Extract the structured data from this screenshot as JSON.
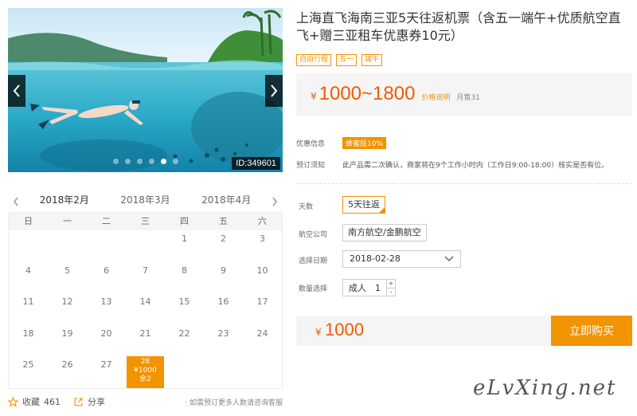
{
  "gallery": {
    "image_id": "ID:349601",
    "active_slide": 4,
    "slide_count": 6
  },
  "calendar": {
    "months": [
      "2018年2月",
      "2018年3月",
      "2018年4月"
    ],
    "active_month": 0,
    "weekdays": [
      "日",
      "一",
      "二",
      "三",
      "四",
      "五",
      "六"
    ],
    "leading_blanks": 4,
    "days": [
      "1",
      "2",
      "3",
      "4",
      "5",
      "6",
      "7",
      "8",
      "9",
      "10",
      "11",
      "12",
      "13",
      "14",
      "15",
      "16",
      "17",
      "18",
      "19",
      "20",
      "21",
      "22",
      "23",
      "24",
      "25",
      "26",
      "27",
      "28"
    ],
    "available_day": {
      "day": "28",
      "price": "¥1000",
      "stock": "余2"
    }
  },
  "footer": {
    "favorite_label": "收藏",
    "favorite_count": "461",
    "share_label": "分享",
    "note": "· 如需预订更多人数请咨询客服"
  },
  "product": {
    "title": "上海直飞海南三亚5天往返机票（含五一端午+优质航空直飞+赠三亚租车优惠券10元）",
    "tags": [
      "自由行程",
      "五一",
      "端午"
    ]
  },
  "price": {
    "currency": "¥",
    "range": "1000~1800",
    "explain": "价格说明",
    "sold": "月售31"
  },
  "info": {
    "promo_label": "优惠信息",
    "promo_value": "蜂蜜抵10%",
    "notice_label": "预订须知",
    "notice_text": "此产品需二次确认，商家将在9个工作小时内（工作日9:00-18:00）核实是否有位。"
  },
  "options": {
    "days_label": "天数",
    "days_value": "5天往返",
    "airline_label": "航空公司",
    "airline_value": "南方航空/金鹏航空",
    "date_label": "选择日期",
    "date_value": "2018-02-28",
    "qty_label": "数量选择",
    "qty_type": "成人",
    "qty_value": "1",
    "qty_plus": "+",
    "qty_minus": "-"
  },
  "purchase": {
    "currency": "¥",
    "total": "1000",
    "buy_label": "立即购买"
  },
  "watermark": "eLvXing.net",
  "colors": {
    "accent": "#f29300",
    "price": "#f05a00"
  }
}
